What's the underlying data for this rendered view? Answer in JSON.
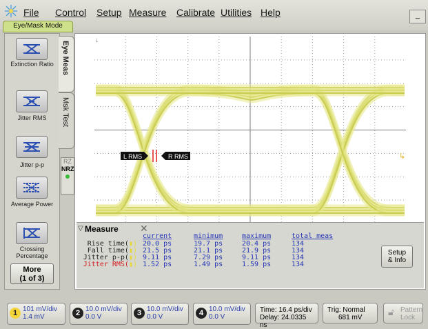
{
  "menu": {
    "items": [
      {
        "label": "File"
      },
      {
        "label": "Control"
      },
      {
        "label": "Setup"
      },
      {
        "label": "Measure"
      },
      {
        "label": "Calibrate"
      },
      {
        "label": "Utilities"
      },
      {
        "label": "Help"
      }
    ],
    "mode_tab": "Eye/Mask Mode",
    "minimize": "_"
  },
  "left_panel": {
    "buttons": [
      {
        "label": "Extinction Ratio",
        "icon": "extinction-ratio-icon"
      },
      {
        "label": "Jitter RMS",
        "icon": "jitter-rms-icon"
      },
      {
        "label": "Jitter p-p",
        "icon": "jitter-pp-icon"
      },
      {
        "label": "Average Power",
        "icon": "average-power-icon"
      },
      {
        "label": "Crossing Percentage",
        "icon": "crossing-percentage-icon"
      }
    ],
    "more_label": "More",
    "more_page": "(1 of 3)"
  },
  "side_tabs": {
    "eye_meas": "Eye Meas",
    "msk_test": "Msk Test",
    "rz": "RZ",
    "nrz": "NRZ"
  },
  "screen": {
    "markers": {
      "left": "L RMS",
      "right": "R RMS"
    },
    "colors": {
      "trace": "#e5e88a",
      "trace_dark": "#c5c94a",
      "grid": "#9a9a9a",
      "marker_red": "#e02020"
    }
  },
  "measure_panel": {
    "title": "Measure",
    "close": "✕",
    "headers": {
      "current": "current",
      "minimum": "minimum",
      "maximum": "maximum",
      "total": "total meas"
    },
    "rows": [
      {
        "name": "Rise time(",
        "current": "20.0 ps",
        "minimum": "19.7 ps",
        "maximum": "20.4 ps",
        "total": "134",
        "highlight": false
      },
      {
        "name": "Fall time(",
        "current": "21.5 ps",
        "minimum": "21.1 ps",
        "maximum": "21.9 ps",
        "total": "134",
        "highlight": false
      },
      {
        "name": "Jitter p-p(",
        "current": "9.11 ps",
        "minimum": "7.29 ps",
        "maximum": "9.11 ps",
        "total": "134",
        "highlight": false
      },
      {
        "name": "Jitter RMS(",
        "current": "1.52 ps",
        "minimum": "1.49 ps",
        "maximum": "1.59 ps",
        "total": "134",
        "highlight": true
      }
    ],
    "setup_label_1": "Setup",
    "setup_label_2": "& Info"
  },
  "bottom_bar": {
    "channels": [
      {
        "num": "1",
        "scale": "101 mV/div",
        "offset": "1.4 mV",
        "color": "#f3d43a"
      },
      {
        "num": "2",
        "scale": "10.0 mV/div",
        "offset": "0.0 V",
        "color": "#222222"
      },
      {
        "num": "3",
        "scale": "10.0 mV/div",
        "offset": "0.0 V",
        "color": "#222222"
      },
      {
        "num": "4",
        "scale": "10.0 mV/div",
        "offset": "0.0 V",
        "color": "#222222"
      }
    ],
    "time": "Time: 16.4 ps/div",
    "delay": "Delay: 24.0335 ns",
    "trig": "Trig: Normal",
    "trig_level": "681 mV",
    "pattern_lock_1": "Pattern",
    "pattern_lock_2": "Lock"
  }
}
